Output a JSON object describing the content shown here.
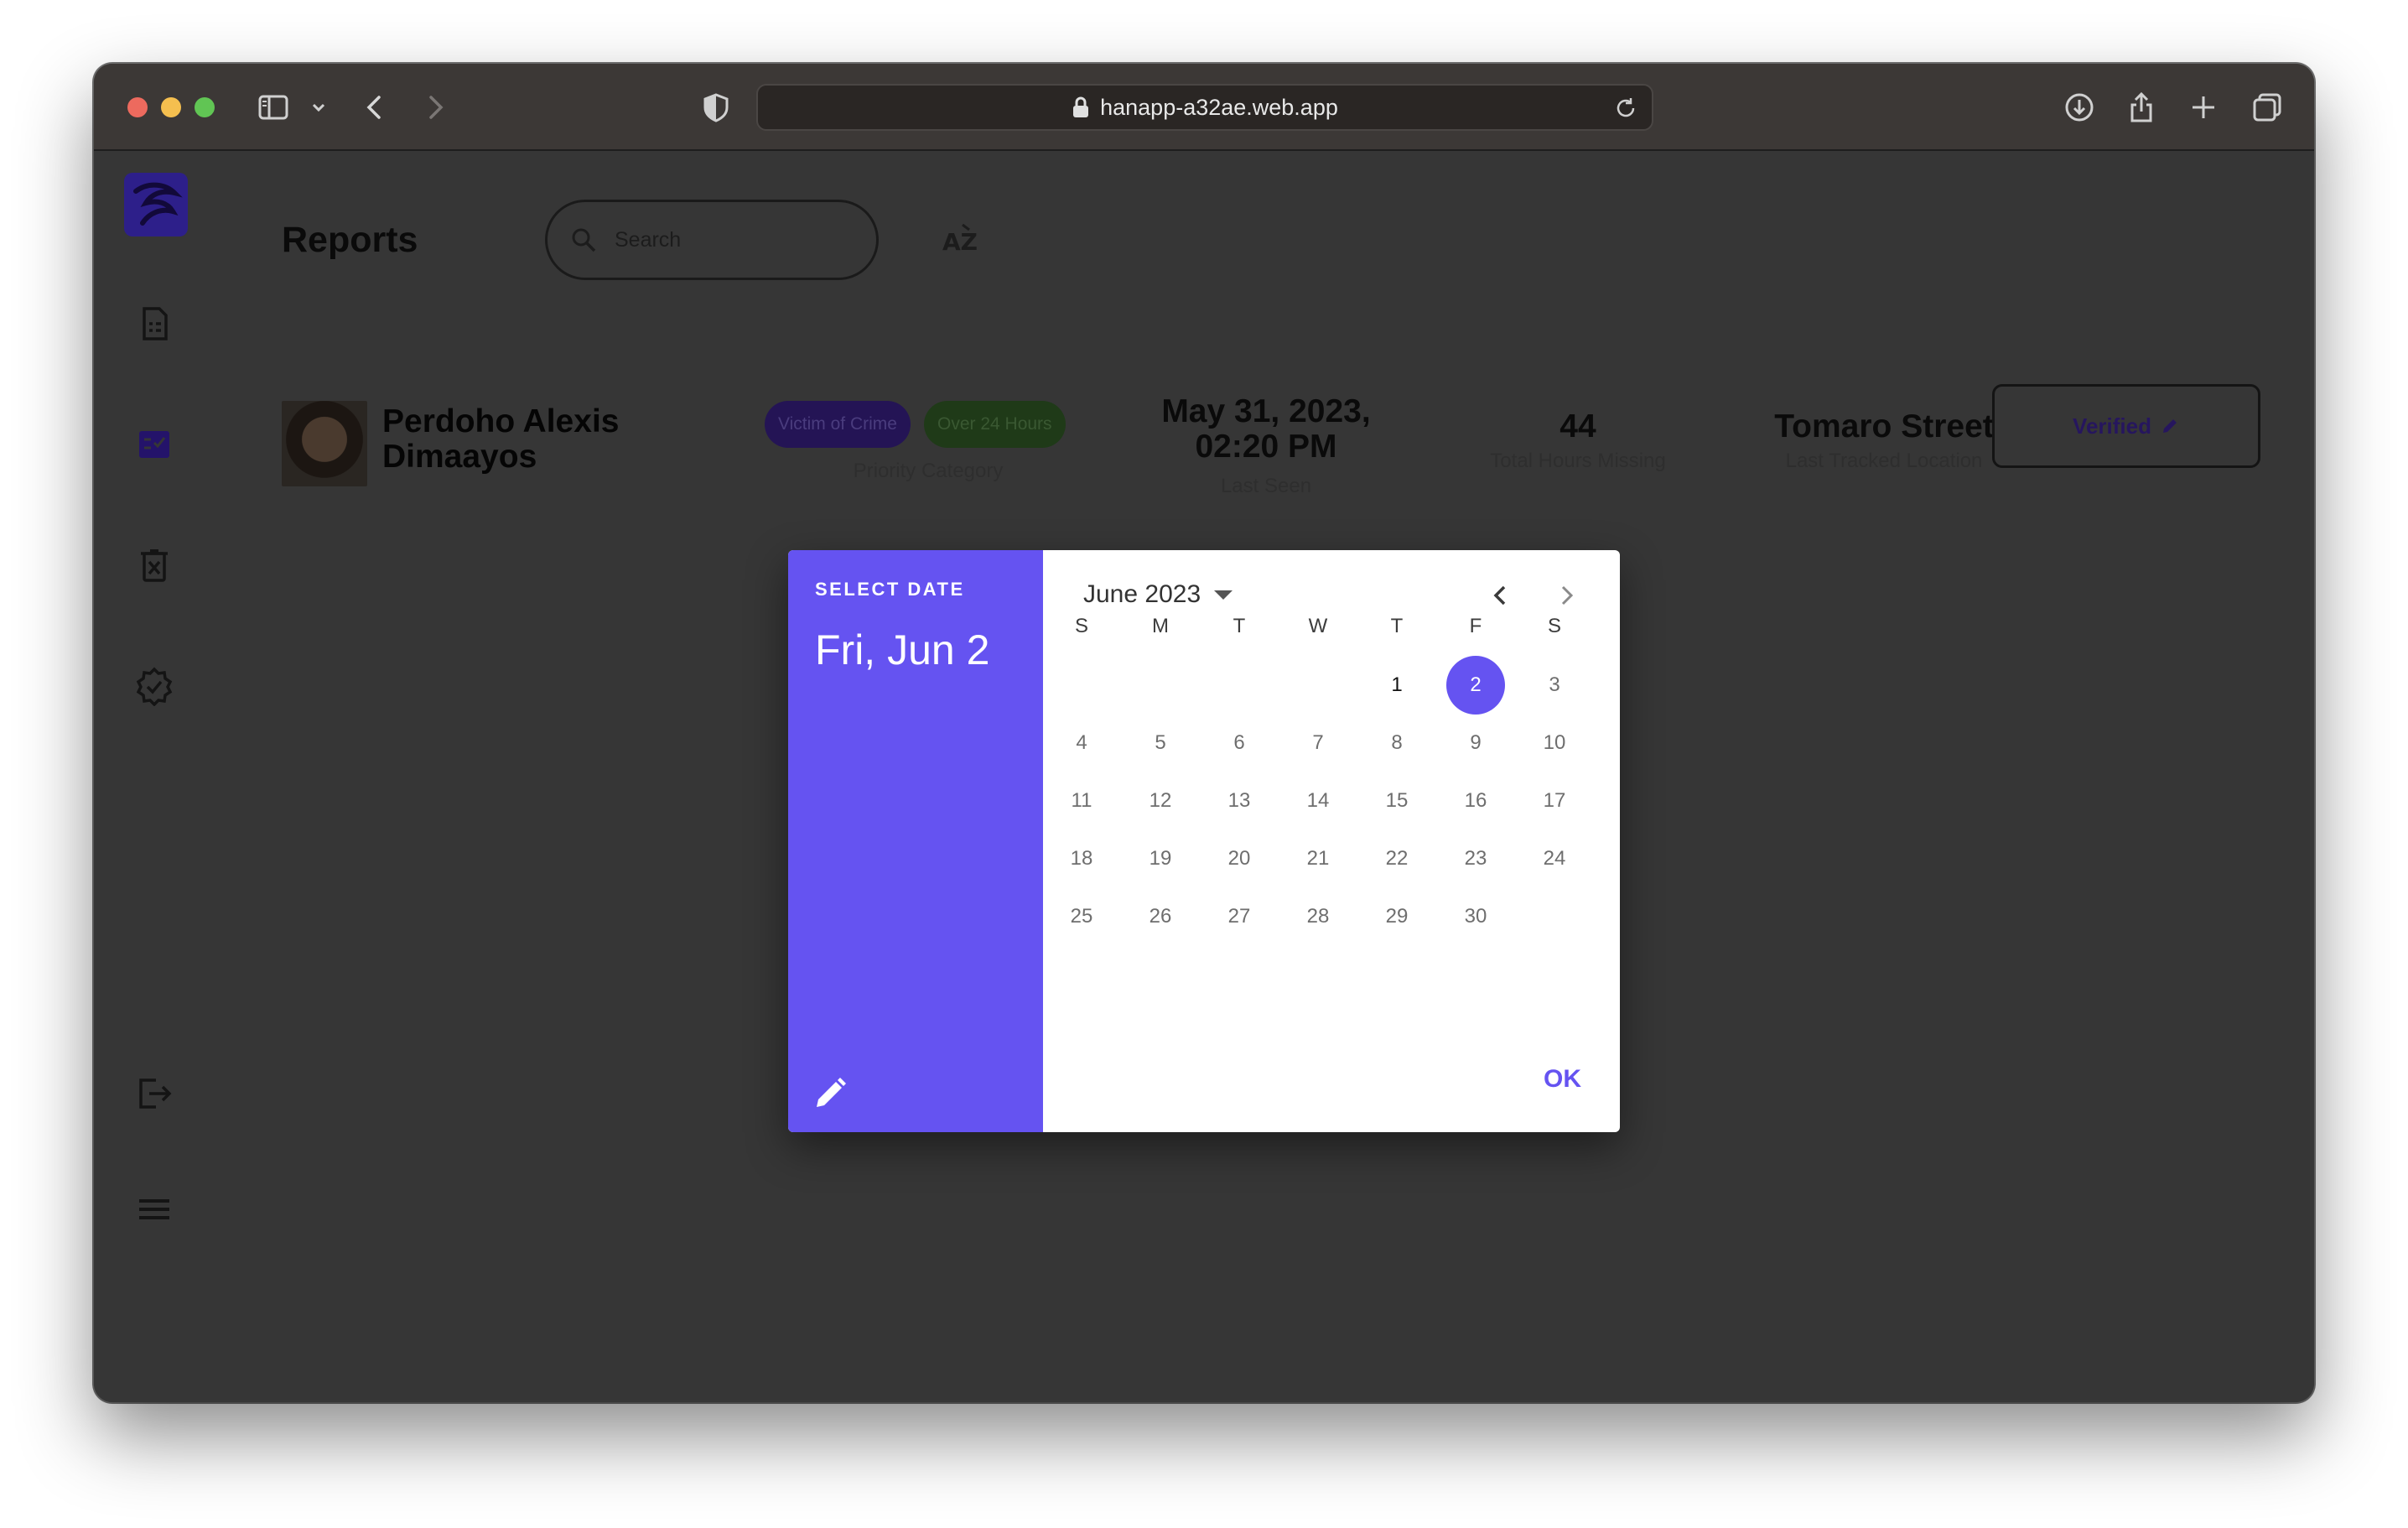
{
  "browser": {
    "url": "hanapp-a32ae.web.app",
    "icons": [
      "sidebar-toggle-icon",
      "chevron-down-icon",
      "back-icon",
      "forward-icon",
      "shield-icon",
      "lock-icon",
      "reload-icon",
      "download-icon",
      "share-icon",
      "new-tab-icon",
      "tab-overview-icon"
    ]
  },
  "sidebar": {
    "items": [
      {
        "name": "reports-icon"
      },
      {
        "name": "checklist-icon"
      },
      {
        "name": "delete-list-icon"
      },
      {
        "name": "verified-icon"
      },
      {
        "name": "logout-icon"
      },
      {
        "name": "menu-icon"
      }
    ]
  },
  "header": {
    "title": "Reports",
    "search_placeholder": "Search",
    "sort_icon": "sort-alpha-icon"
  },
  "report": {
    "name_line1": "Perdoho Alexis",
    "name_line2": "Dimaayos",
    "badges": [
      "Victim of Crime",
      "Over 24 Hours"
    ],
    "priority_label": "Priority Category",
    "last_seen_line1": "May 31, 2023,",
    "last_seen_line2": "02:20 PM",
    "last_seen_label": "Last Seen",
    "hours_missing": "44",
    "hours_missing_label": "Total Hours Missing",
    "location": "Tomaro Street",
    "location_label": "Last Tracked Location",
    "status_button": "Verified"
  },
  "datepicker": {
    "overline": "SELECT DATE",
    "selected_label": "Fri, Jun 2",
    "month_label": "June 2023",
    "weekdays": [
      "S",
      "M",
      "T",
      "W",
      "T",
      "F",
      "S"
    ],
    "first_weekday_index": 4,
    "days_in_month": 30,
    "today": 1,
    "selected_day": 2,
    "ok_label": "OK",
    "accent": "#6553f1"
  }
}
